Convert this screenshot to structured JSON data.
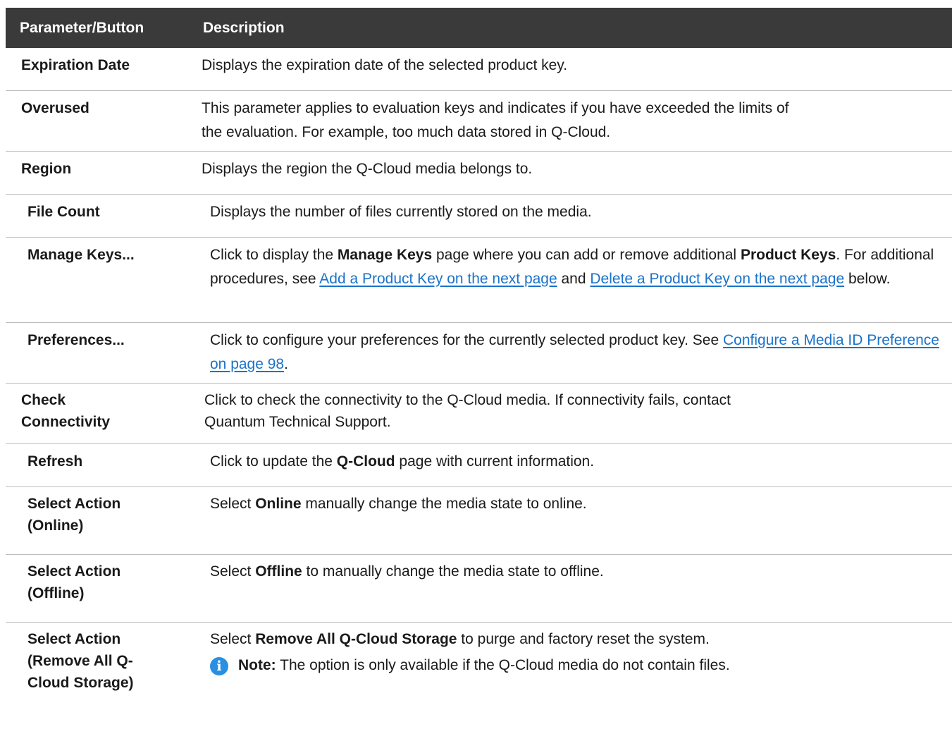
{
  "header": {
    "col_param": "Parameter/Button",
    "col_desc": "Description"
  },
  "rows": [
    {
      "param": "Expiration Date",
      "desc": "Displays the expiration date of the selected product key."
    },
    {
      "param": "Overused",
      "desc_line1": "This parameter applies to evaluation keys and indicates if you have exceeded the limits of",
      "desc_line2": "the evaluation. For example, too much data stored in Q-Cloud."
    },
    {
      "param": "Region",
      "desc": "Displays the region the Q-Cloud media belongs to."
    },
    {
      "param": "File Count",
      "desc": "Displays the number of files currently stored on the media."
    },
    {
      "param": "Manage Keys...",
      "desc_pre": "Click to display the ",
      "desc_bold1": "Manage Keys",
      "desc_mid": " page where you can add or remove additional ",
      "desc_bold2": "Product Keys",
      "desc_mid2": ". For additional procedures, see ",
      "link1": "Add a Product Key on the next page",
      "desc_and": " and ",
      "link2": "Delete a Product Key on the next page",
      "desc_post": " below."
    },
    {
      "param": "Preferences...",
      "desc_pre": "Click to configure your preferences for the currently selected product key. See ",
      "link1": "Configure a Media ID Preference on page 98",
      "desc_post": "."
    },
    {
      "param_line1": "Check",
      "param_line2": "Connectivity",
      "desc_line1": "Click to check the connectivity to the Q-Cloud media. If connectivity fails, contact",
      "desc_line2": "Quantum Technical Support."
    },
    {
      "param": "Refresh",
      "desc_pre": "Click to update the ",
      "desc_bold1": "Q-Cloud",
      "desc_post": " page with current information."
    },
    {
      "param_line1": "Select Action",
      "param_line2": "(Online)",
      "desc_pre": "Select ",
      "desc_bold1": "Online",
      "desc_post": " manually change the media state to online."
    },
    {
      "param_line1": "Select Action",
      "param_line2": "(Offline)",
      "desc_pre": "Select ",
      "desc_bold1": "Offline",
      "desc_post": " to manually change the media state to offline."
    },
    {
      "param_line1": "Select Action",
      "param_line2": "(Remove All Q-",
      "param_line3": "Cloud Storage)",
      "desc_pre": "Select ",
      "desc_bold1": "Remove All Q-Cloud Storage",
      "desc_post": " to purge and factory reset the system.",
      "note_label": "Note:",
      "note_text": " The option is only available if the Q-Cloud media do not contain files.",
      "note_icon": "info-icon"
    }
  ]
}
